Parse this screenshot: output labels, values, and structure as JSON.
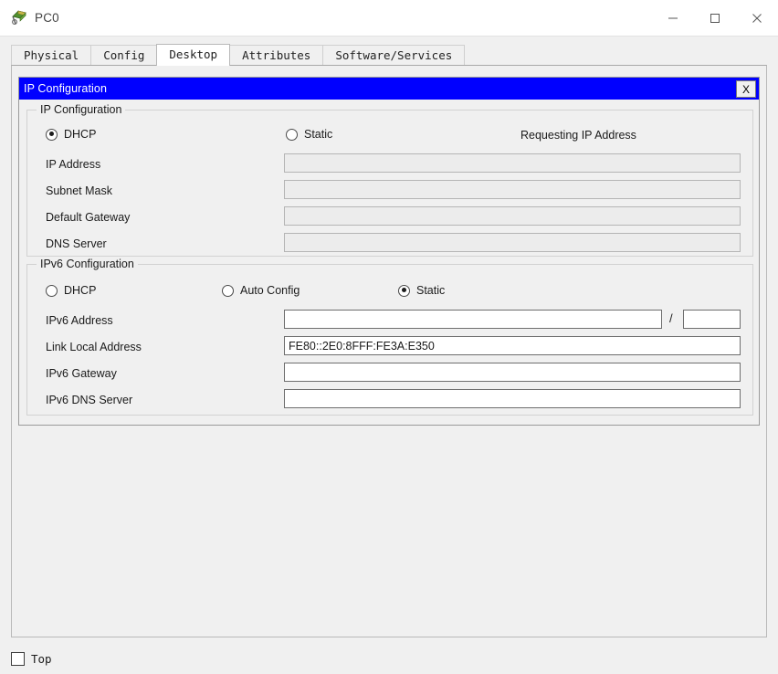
{
  "window": {
    "title": "PC0",
    "icon": "packet-tracer-pc-icon",
    "minimize_label": "─",
    "maximize_label": "□",
    "close_label": "✕"
  },
  "tabs": [
    {
      "label": "Physical",
      "active": false
    },
    {
      "label": "Config",
      "active": false
    },
    {
      "label": "Desktop",
      "active": true
    },
    {
      "label": "Attributes",
      "active": false
    },
    {
      "label": "Software/Services",
      "active": false
    }
  ],
  "ip_window": {
    "title": "IP Configuration",
    "close_label": "X"
  },
  "ipv4": {
    "legend": "IP Configuration",
    "mode_dhcp": "DHCP",
    "mode_static": "Static",
    "selected_mode": "DHCP",
    "status": "Requesting IP Address",
    "fields": [
      {
        "label": "IP Address",
        "value": "",
        "enabled": false
      },
      {
        "label": "Subnet Mask",
        "value": "",
        "enabled": false
      },
      {
        "label": "Default Gateway",
        "value": "",
        "enabled": false
      },
      {
        "label": "DNS Server",
        "value": "",
        "enabled": false
      }
    ]
  },
  "ipv6": {
    "legend": "IPv6 Configuration",
    "mode_dhcp": "DHCP",
    "mode_auto": "Auto Config",
    "mode_static": "Static",
    "selected_mode": "Static",
    "prefix_separator": "/",
    "address_label": "IPv6 Address",
    "address_value": "",
    "prefix_value": "",
    "link_local_label": "Link Local Address",
    "link_local_value": "FE80::2E0:8FFF:FE3A:E350",
    "gateway_label": "IPv6 Gateway",
    "gateway_value": "",
    "dns_label": "IPv6 DNS Server",
    "dns_value": ""
  },
  "footer": {
    "top_label": "Top",
    "top_checked": false
  },
  "colors": {
    "title_bar": "#0000ff",
    "title_text": "#ffffff",
    "window_bg": "#f0f0f0",
    "field_disabled": "#ececec",
    "field_enabled": "#ffffff"
  }
}
